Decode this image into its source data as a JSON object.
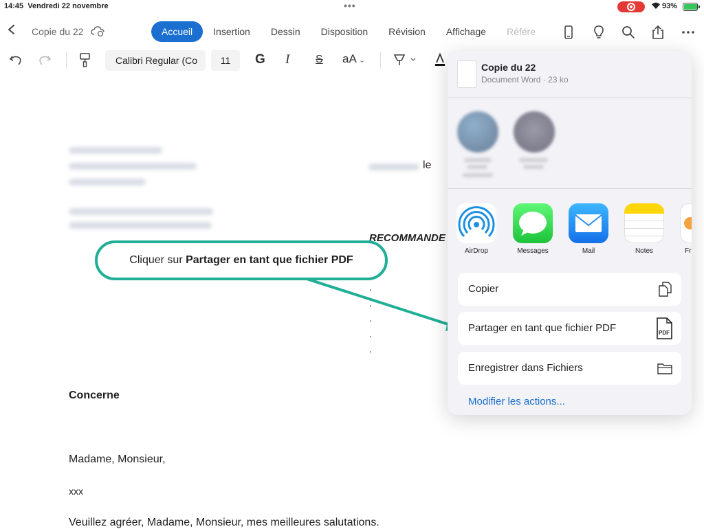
{
  "status": {
    "time": "14:45",
    "date": "Vendredi 22 novembre",
    "battery": "93%"
  },
  "header": {
    "doc_title": "Copie du 22",
    "tabs": [
      "Accueil",
      "Insertion",
      "Dessin",
      "Disposition",
      "Révision",
      "Affichage",
      "Référe"
    ]
  },
  "toolbar": {
    "font": "Calibri Regular (Co",
    "size": "11",
    "bold": "G",
    "italic": "I",
    "strike": "S",
    "case": "aA"
  },
  "doc": {
    "place_suffix": "le",
    "recommande": "RECOMMANDE",
    "concerne": "Concerne",
    "greeting": "Madame, Monsieur,",
    "body": "xxx",
    "closing": "Veuillez agréer, Madame, Monsieur, mes meilleures salutations."
  },
  "callout": {
    "prefix": "Cliquer sur ",
    "bold": "Partager en tant que fichier PDF"
  },
  "share": {
    "title": "Copie du 22",
    "subtitle": "Document Word · 23 ko",
    "apps": [
      "AirDrop",
      "Messages",
      "Mail",
      "Notes",
      "Fr"
    ],
    "actions": [
      "Copier",
      "Partager en tant que fichier PDF",
      "Enregistrer dans Fichiers"
    ],
    "modify": "Modifier les actions..."
  },
  "colors": {
    "accent": "#1a6fd0",
    "callout": "#1fae96"
  }
}
